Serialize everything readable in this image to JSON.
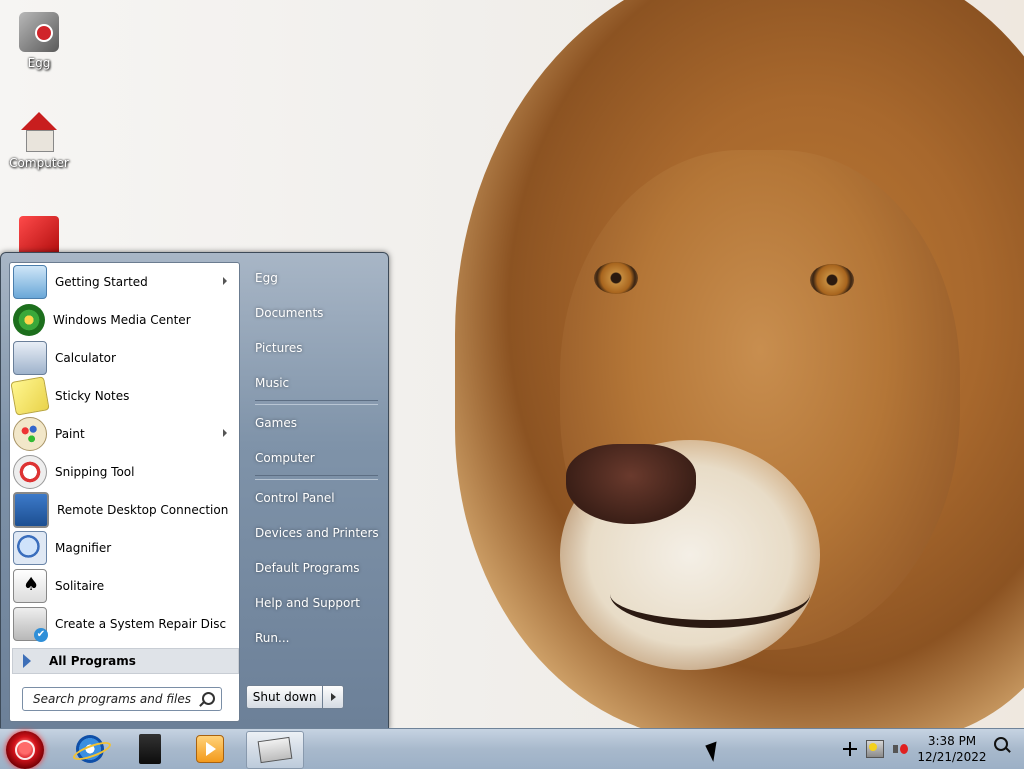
{
  "desktop": {
    "icons": [
      {
        "label": "Egg",
        "icon": "egg-app-icon"
      },
      {
        "label": "Computer",
        "icon": "computer-icon"
      },
      {
        "label": "",
        "icon": "red-app-icon"
      }
    ]
  },
  "start_menu": {
    "programs": [
      {
        "label": "Getting Started",
        "icon": "getting-started-icon",
        "submenu": true
      },
      {
        "label": "Windows Media Center",
        "icon": "windows-media-center-icon",
        "submenu": false
      },
      {
        "label": "Calculator",
        "icon": "calculator-icon",
        "submenu": false
      },
      {
        "label": "Sticky Notes",
        "icon": "sticky-notes-icon",
        "submenu": false
      },
      {
        "label": "Paint",
        "icon": "paint-icon",
        "submenu": true
      },
      {
        "label": "Snipping Tool",
        "icon": "snipping-tool-icon",
        "submenu": false
      },
      {
        "label": "Remote Desktop Connection",
        "icon": "remote-desktop-icon",
        "submenu": false
      },
      {
        "label": "Magnifier",
        "icon": "magnifier-icon",
        "submenu": false
      },
      {
        "label": "Solitaire",
        "icon": "solitaire-icon",
        "submenu": false
      },
      {
        "label": "Create a System Repair Disc",
        "icon": "repair-disc-icon",
        "submenu": false
      }
    ],
    "all_programs_label": "All Programs",
    "search_placeholder": "Search programs and files",
    "places": {
      "group1": [
        "Egg",
        "Documents",
        "Pictures",
        "Music"
      ],
      "group2": [
        "Games",
        "Computer"
      ],
      "group3": [
        "Control Panel",
        "Devices and Printers",
        "Default Programs",
        "Help and Support",
        "Run..."
      ]
    },
    "shutdown_label": "Shut down"
  },
  "taskbar": {
    "pinned": [
      {
        "name": "internet-explorer-icon"
      },
      {
        "name": "playstation-icon"
      },
      {
        "name": "media-player-icon"
      },
      {
        "name": "game-app-icon",
        "active": true
      }
    ],
    "tray": {
      "time": "3:38 PM",
      "date": "12/21/2022"
    }
  },
  "colors": {
    "start_orb": "#d0131b",
    "start_menu_pane": "#8da0b6",
    "taskbar": "#a8b9cc"
  }
}
